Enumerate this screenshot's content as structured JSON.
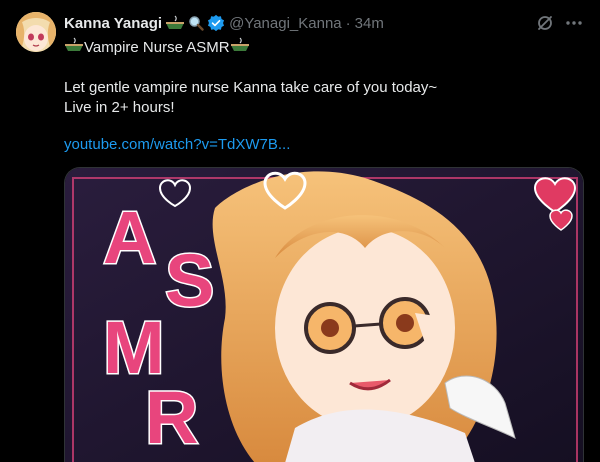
{
  "tweet": {
    "display_name": "Kanna Yanagi",
    "handle": "@Yanagi_Kanna",
    "separator": "·",
    "time": "34m",
    "subtitle": "Vampire Nurse ASMR",
    "body_line1": "Let gentle vampire nurse Kanna take care of you today~",
    "body_line2": "Live in 2+ hours!",
    "link": "youtube.com/watch?v=TdXW7B...",
    "media_text": [
      "A",
      "S",
      "M",
      "R"
    ]
  },
  "icons": {
    "name_emojis": [
      "bowl-icon",
      "magnifier-icon"
    ],
    "verified": "verified-badge-icon",
    "grok": "grok-icon",
    "more": "more-icon"
  },
  "colors": {
    "background": "#000000",
    "text": "#e7e9ea",
    "muted": "#71767b",
    "link": "#1d9bf0",
    "verified": "#1d9bf0",
    "asmr_pink": "#e8457d"
  }
}
